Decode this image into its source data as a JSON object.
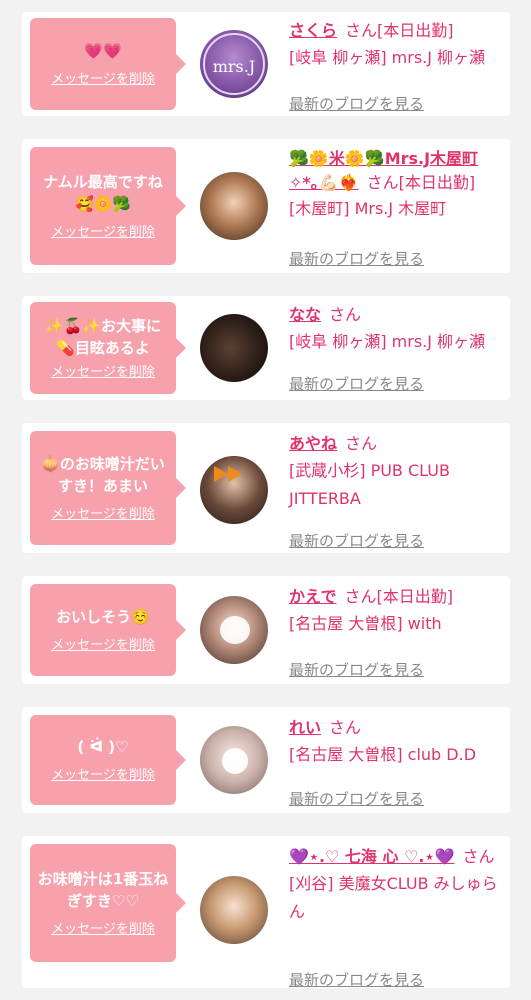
{
  "delete_label": "メッセージを削除",
  "blog_label": "最新のブログを見る",
  "san_label": "さん",
  "colors": {
    "accent_pink": "#f7a1ad",
    "name_pink": "#e0336a",
    "background": "#f2f2f2",
    "link_gray": "#888888"
  },
  "entries": [
    {
      "message": "💗💗",
      "name": "さくら",
      "badge": "[本日出勤]",
      "shop": "[岐阜 柳ヶ瀬] mrs.J 柳ヶ瀬",
      "avatar_logo_text": "mrs.J"
    },
    {
      "message": "ナムル最高ですね🥰🌼🥦",
      "name": "🥦🌼米🌼🥦Mrs.J木屋町✧*｡💪🏻❤️‍🔥",
      "badge": "[本日出勤]",
      "shop": "[木屋町] Mrs.J 木屋町"
    },
    {
      "message": "✨🍒✨お大事に💊目眩あるよ",
      "name": "なな",
      "badge": "",
      "shop": "[岐阜 柳ヶ瀬] mrs.J 柳ヶ瀬"
    },
    {
      "message": "🧅のお味噌汁だいすき！あまい",
      "name": "あやね",
      "badge": "",
      "shop": "[武蔵小杉] PUB CLUB JITTERBA"
    },
    {
      "message": "おいしそう☺️",
      "name": "かえで",
      "badge": "[本日出勤]",
      "shop": "[名古屋 大曽根] with"
    },
    {
      "message": "( ᐛ )♡",
      "name": "れい",
      "badge": "",
      "shop": "[名古屋 大曽根] club D.D"
    },
    {
      "message": "お味噌汁は1番玉ねぎすき♡♡",
      "name": "💜⋆.♡ 七海 心 ♡.⋆💜",
      "badge": "",
      "shop": "[刈谷] 美魔女CLUB みしゅらん"
    }
  ]
}
